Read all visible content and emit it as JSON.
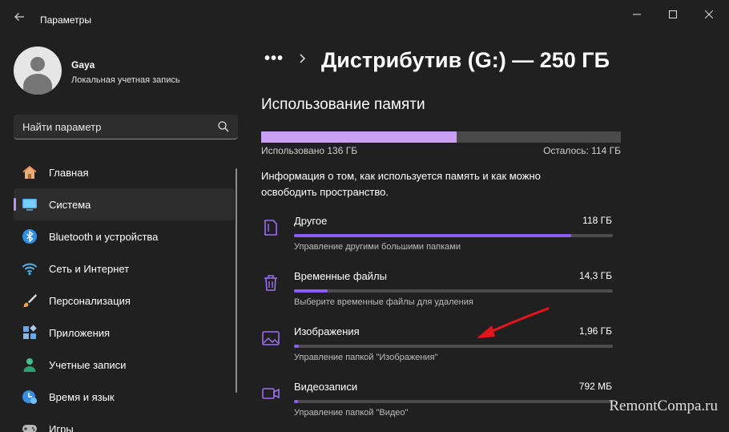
{
  "window": {
    "title": "Параметры",
    "controls": [
      "minimize-icon",
      "maximize-icon",
      "close-icon"
    ]
  },
  "user": {
    "name": "Gaya",
    "account_type": "Локальная учетная запись"
  },
  "search": {
    "placeholder": "Найти параметр"
  },
  "sidebar": {
    "items": [
      {
        "label": "Главная",
        "icon": "home-icon",
        "active": false
      },
      {
        "label": "Система",
        "icon": "system-icon",
        "active": true
      },
      {
        "label": "Bluetooth и устройства",
        "icon": "bluetooth-icon",
        "active": false
      },
      {
        "label": "Сеть и Интернет",
        "icon": "wifi-icon",
        "active": false
      },
      {
        "label": "Персонализация",
        "icon": "brush-icon",
        "active": false
      },
      {
        "label": "Приложения",
        "icon": "apps-icon",
        "active": false
      },
      {
        "label": "Учетные записи",
        "icon": "accounts-icon",
        "active": false
      },
      {
        "label": "Время и язык",
        "icon": "time-language-icon",
        "active": false
      },
      {
        "label": "Игры",
        "icon": "gaming-icon",
        "active": false
      }
    ]
  },
  "breadcrumb": {
    "more": "•••",
    "title": "Дистрибутив (G:) — 250 ГБ"
  },
  "memory": {
    "section_title": "Использование памяти",
    "used_label": "Использовано 136 ГБ",
    "free_label": "Осталось: 114 ГБ",
    "used_fraction": 0.544,
    "info": "Информация о том, как используется память и как можно освободить пространство.",
    "accent": "#c8a0f4"
  },
  "categories": [
    {
      "name": "Другое",
      "size": "118 ГБ",
      "desc": "Управление другими большими папками",
      "icon": "document-icon",
      "fraction": 0.87
    },
    {
      "name": "Временные файлы",
      "size": "14,3 ГБ",
      "desc": "Выберите временные файлы для удаления",
      "icon": "trash-icon",
      "fraction": 0.105
    },
    {
      "name": "Изображения",
      "size": "1,96 ГБ",
      "desc": "Управление папкой \"Изображения\"",
      "icon": "image-icon",
      "fraction": 0.014
    },
    {
      "name": "Видеозаписи",
      "size": "792 МБ",
      "desc": "Управление папкой \"Видео\"",
      "icon": "video-icon",
      "fraction": 0.006
    }
  ],
  "watermark": "RemontCompa.ru"
}
